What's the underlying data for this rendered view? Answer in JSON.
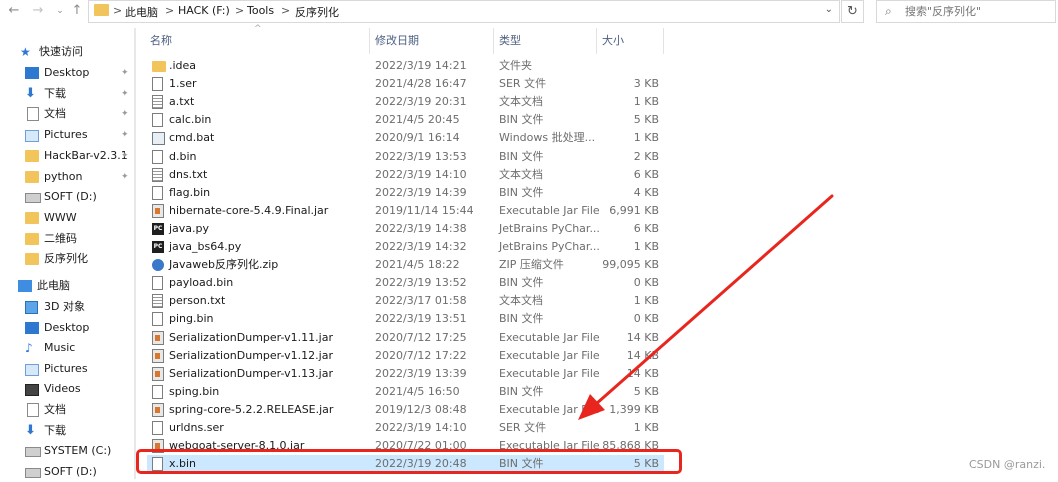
{
  "address_bar": {
    "breadcrumbs": [
      "此电脑",
      "HACK (F:)",
      "Tools",
      "反序列化"
    ],
    "separator": ">",
    "search_placeholder": "搜索\"反序列化\""
  },
  "nav": {
    "quick_access": "快速访问",
    "items": [
      {
        "label": "Desktop",
        "icon": "desktop-icon",
        "pinned": true
      },
      {
        "label": "下载",
        "icon": "download-arrow-icon",
        "pinned": true
      },
      {
        "label": "文档",
        "icon": "document-icon",
        "pinned": true
      },
      {
        "label": "Pictures",
        "icon": "pictures-icon",
        "pinned": true
      },
      {
        "label": "HackBar-v2.3.1",
        "icon": "folder-icon",
        "pinned": true
      },
      {
        "label": "python",
        "icon": "folder-icon",
        "pinned": true
      },
      {
        "label": "SOFT (D:)",
        "icon": "drive-icon",
        "pinned": false
      },
      {
        "label": "WWW",
        "icon": "folder-icon",
        "pinned": false
      },
      {
        "label": "二维码",
        "icon": "folder-icon",
        "pinned": false
      },
      {
        "label": "反序列化",
        "icon": "folder-icon",
        "pinned": false
      }
    ],
    "this_pc": "此电脑",
    "pc_items": [
      {
        "label": "3D 对象",
        "icon": "3d-objects-icon"
      },
      {
        "label": "Desktop",
        "icon": "desktop-icon"
      },
      {
        "label": "Music",
        "icon": "music-icon"
      },
      {
        "label": "Pictures",
        "icon": "pictures-icon"
      },
      {
        "label": "Videos",
        "icon": "videos-icon"
      },
      {
        "label": "文档",
        "icon": "document-icon"
      },
      {
        "label": "下载",
        "icon": "download-arrow-icon"
      },
      {
        "label": "SYSTEM (C:)",
        "icon": "drive-icon"
      },
      {
        "label": "SOFT (D:)",
        "icon": "drive-icon"
      }
    ]
  },
  "columns": {
    "name": "名称",
    "date": "修改日期",
    "type": "类型",
    "size": "大小"
  },
  "files": [
    {
      "name": ".idea",
      "date": "2022/3/19 14:21",
      "type": "文件夹",
      "size": "",
      "icon": "folder"
    },
    {
      "name": "1.ser",
      "date": "2021/4/28 16:47",
      "type": "SER 文件",
      "size": "3 KB",
      "icon": "file"
    },
    {
      "name": "a.txt",
      "date": "2022/3/19 20:31",
      "type": "文本文档",
      "size": "1 KB",
      "icon": "text"
    },
    {
      "name": "calc.bin",
      "date": "2021/4/5 20:45",
      "type": "BIN 文件",
      "size": "5 KB",
      "icon": "file"
    },
    {
      "name": "cmd.bat",
      "date": "2020/9/1 16:14",
      "type": "Windows 批处理...",
      "size": "1 KB",
      "icon": "bat"
    },
    {
      "name": "d.bin",
      "date": "2022/3/19 13:53",
      "type": "BIN 文件",
      "size": "2 KB",
      "icon": "file"
    },
    {
      "name": "dns.txt",
      "date": "2022/3/19 14:10",
      "type": "文本文档",
      "size": "6 KB",
      "icon": "text"
    },
    {
      "name": "flag.bin",
      "date": "2022/3/19 14:39",
      "type": "BIN 文件",
      "size": "4 KB",
      "icon": "file"
    },
    {
      "name": "hibernate-core-5.4.9.Final.jar",
      "date": "2019/11/14 15:44",
      "type": "Executable Jar File",
      "size": "6,991 KB",
      "icon": "jar"
    },
    {
      "name": "java.py",
      "date": "2022/3/19 14:38",
      "type": "JetBrains PyChar...",
      "size": "6 KB",
      "icon": "py"
    },
    {
      "name": "java_bs64.py",
      "date": "2022/3/19 14:32",
      "type": "JetBrains PyChar...",
      "size": "1 KB",
      "icon": "py"
    },
    {
      "name": "Javaweb反序列化.zip",
      "date": "2021/4/5 18:22",
      "type": "ZIP 压缩文件",
      "size": "99,095 KB",
      "icon": "zip"
    },
    {
      "name": "payload.bin",
      "date": "2022/3/19 13:52",
      "type": "BIN 文件",
      "size": "0 KB",
      "icon": "file"
    },
    {
      "name": "person.txt",
      "date": "2022/3/17 01:58",
      "type": "文本文档",
      "size": "1 KB",
      "icon": "text"
    },
    {
      "name": "ping.bin",
      "date": "2022/3/19 13:51",
      "type": "BIN 文件",
      "size": "0 KB",
      "icon": "file"
    },
    {
      "name": "SerializationDumper-v1.11.jar",
      "date": "2020/7/12 17:25",
      "type": "Executable Jar File",
      "size": "14 KB",
      "icon": "jar"
    },
    {
      "name": "SerializationDumper-v1.12.jar",
      "date": "2020/7/12 17:22",
      "type": "Executable Jar File",
      "size": "14 KB",
      "icon": "jar"
    },
    {
      "name": "SerializationDumper-v1.13.jar",
      "date": "2022/3/19 13:39",
      "type": "Executable Jar File",
      "size": "14 KB",
      "icon": "jar"
    },
    {
      "name": "sping.bin",
      "date": "2021/4/5 16:50",
      "type": "BIN 文件",
      "size": "5 KB",
      "icon": "file"
    },
    {
      "name": "spring-core-5.2.2.RELEASE.jar",
      "date": "2019/12/3 08:48",
      "type": "Executable Jar File",
      "size": "1,399 KB",
      "icon": "jar"
    },
    {
      "name": "urldns.ser",
      "date": "2022/3/19 14:10",
      "type": "SER 文件",
      "size": "1 KB",
      "icon": "file"
    },
    {
      "name": "webgoat-server-8.1.0.jar",
      "date": "2020/7/22 01:00",
      "type": "Executable Jar File",
      "size": "85,868 KB",
      "icon": "jar"
    },
    {
      "name": "x.bin",
      "date": "2022/3/19 20:48",
      "type": "BIN 文件",
      "size": "5 KB",
      "icon": "file",
      "selected": true
    }
  ],
  "watermark": "CSDN @ranzi.",
  "annotation_color": "#e8261d"
}
